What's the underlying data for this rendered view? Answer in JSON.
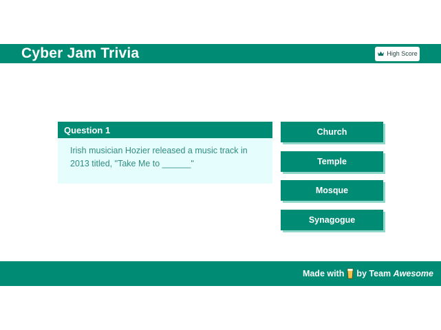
{
  "header": {
    "title": "Cyber Jam Trivia",
    "high_score_label": "High Score"
  },
  "question": {
    "heading": "Question 1",
    "text": "Irish musician Hozier released a music track in 2013 titled, \"Take Me to ______\""
  },
  "answers": [
    {
      "label": "Church"
    },
    {
      "label": "Temple"
    },
    {
      "label": "Mosque"
    },
    {
      "label": "Synagogue"
    }
  ],
  "footer": {
    "made_with": "Made with",
    "by_team": "by Team",
    "team_name": "Awesome",
    "icon": "drink-icon"
  },
  "colors": {
    "primary": "#008c74",
    "question_bg": "#e6fdfd",
    "question_text": "#2f8c80",
    "button_shadow": "#8fd8c9"
  }
}
